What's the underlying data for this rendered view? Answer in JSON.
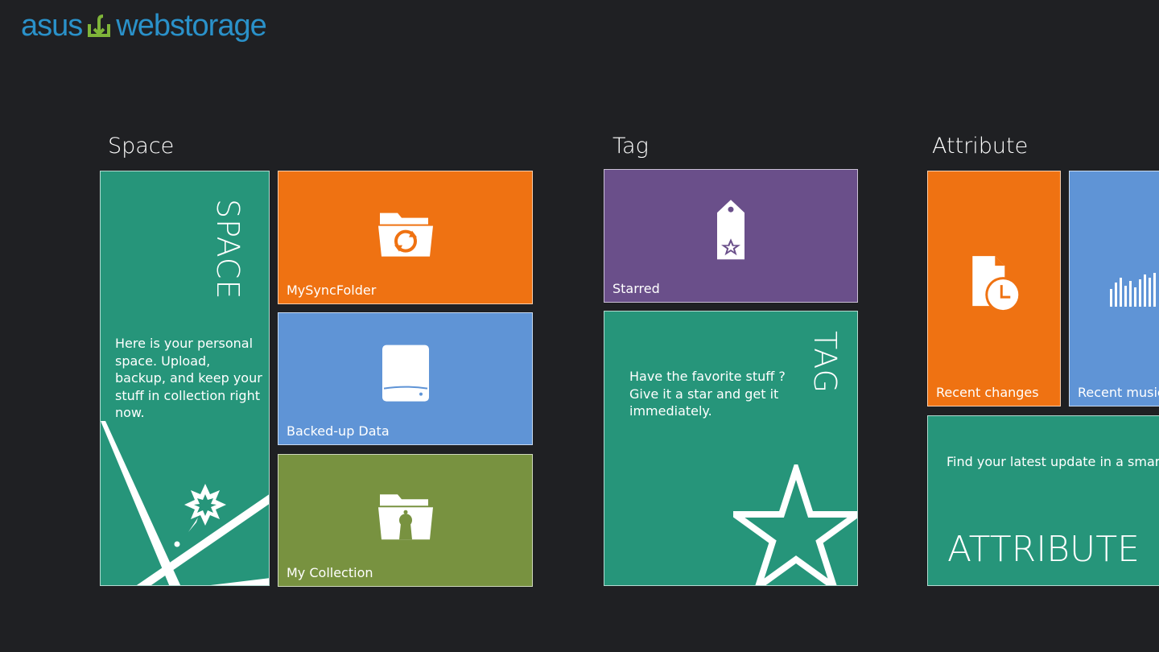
{
  "app": {
    "logo_part1": "asus",
    "logo_part2": "webstorage",
    "brand_color": "#2a91c9",
    "mark_color": "#7fb539"
  },
  "groups": {
    "space": {
      "title": "Space",
      "hero": {
        "title": "SPACE",
        "description": "Here is your personal space. Upload, backup, and keep your stuff in collection right now."
      },
      "tiles": [
        {
          "label": "MySyncFolder",
          "icon": "sync-folder-icon",
          "color": "#ef7212"
        },
        {
          "label": "Backed-up Data",
          "icon": "hard-drive-icon",
          "color": "#5f94d6"
        },
        {
          "label": "My Collection",
          "icon": "collection-folder-icon",
          "color": "#789240"
        }
      ]
    },
    "tag": {
      "title": "Tag",
      "tiles": [
        {
          "label": "Starred",
          "icon": "star-tag-icon",
          "color": "#6a4f8a"
        }
      ],
      "hero": {
        "title": "TAG",
        "description": "Have the favorite stuff ? Give it a star and get it immediately."
      }
    },
    "attribute": {
      "title": "Attribute",
      "tiles": [
        {
          "label": "Recent changes",
          "icon": "recent-file-clock-icon",
          "color": "#ef7212"
        },
        {
          "label": "Recent music",
          "icon": "audio-wave-icon",
          "color": "#5f94d6"
        }
      ],
      "hero": {
        "title": "ATTRIBUTE",
        "description": "Find your latest update in a smart"
      }
    }
  }
}
